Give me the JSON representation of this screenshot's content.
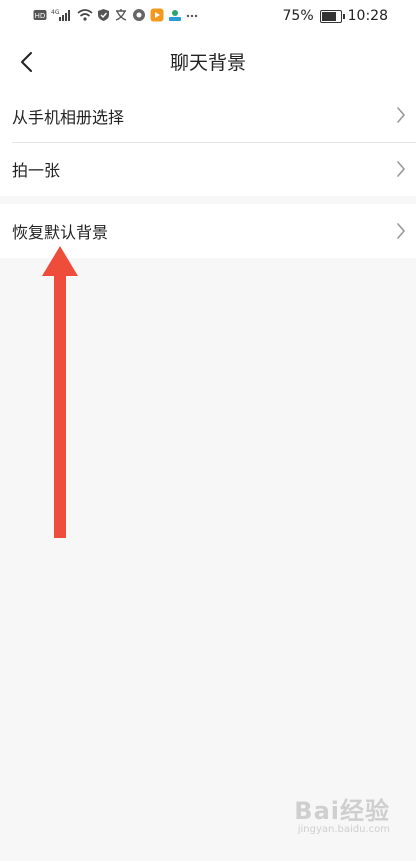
{
  "status_bar": {
    "battery_percent": "75%",
    "time": "10:28",
    "battery_level": 0.75,
    "left_icons": [
      "hd-icon",
      "signal-icon",
      "wifi-icon",
      "shield-icon",
      "translate-icon",
      "app-icon",
      "app-icon-orange",
      "app-icon-green",
      "more-icon"
    ]
  },
  "header": {
    "title": "聊天背景"
  },
  "menu": {
    "items": [
      {
        "label": "从手机相册选择"
      },
      {
        "label": "拍一张"
      },
      {
        "label": "恢复默认背景"
      }
    ]
  },
  "annotation": {
    "arrow_color": "#ef4d3c"
  },
  "watermark": {
    "brand": "Bai经验",
    "url": "jingyan.baidu.com"
  }
}
